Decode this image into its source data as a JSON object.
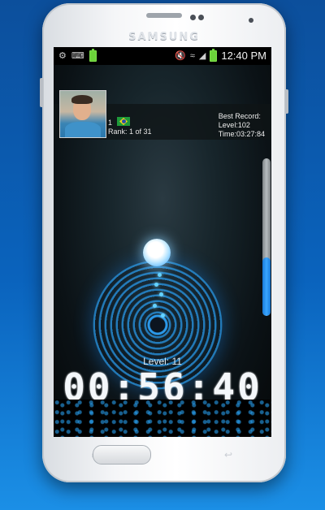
{
  "device": {
    "brand": "SAMSUNG"
  },
  "status_bar": {
    "left_icons": [
      "usb-icon",
      "keyboard-icon",
      "battery-charge-icon"
    ],
    "right_icons": [
      "mute-icon",
      "wifi-icon",
      "signal-icon",
      "battery-icon"
    ],
    "time": "12:40 PM"
  },
  "player": {
    "number": "1",
    "flag": "brazil-flag-icon",
    "rank_text": "Rank: 1 of 31"
  },
  "best_record": {
    "title": "Best Record:",
    "level": "Level:102",
    "time": "Time:03:27:84"
  },
  "progress": {
    "fill_fraction": 0.37
  },
  "game": {
    "level_label": "Level: 11",
    "timer": "00:56:40"
  },
  "colors": {
    "accent_blue": "#2ea6ff",
    "background_blue": "#0a63bd"
  }
}
